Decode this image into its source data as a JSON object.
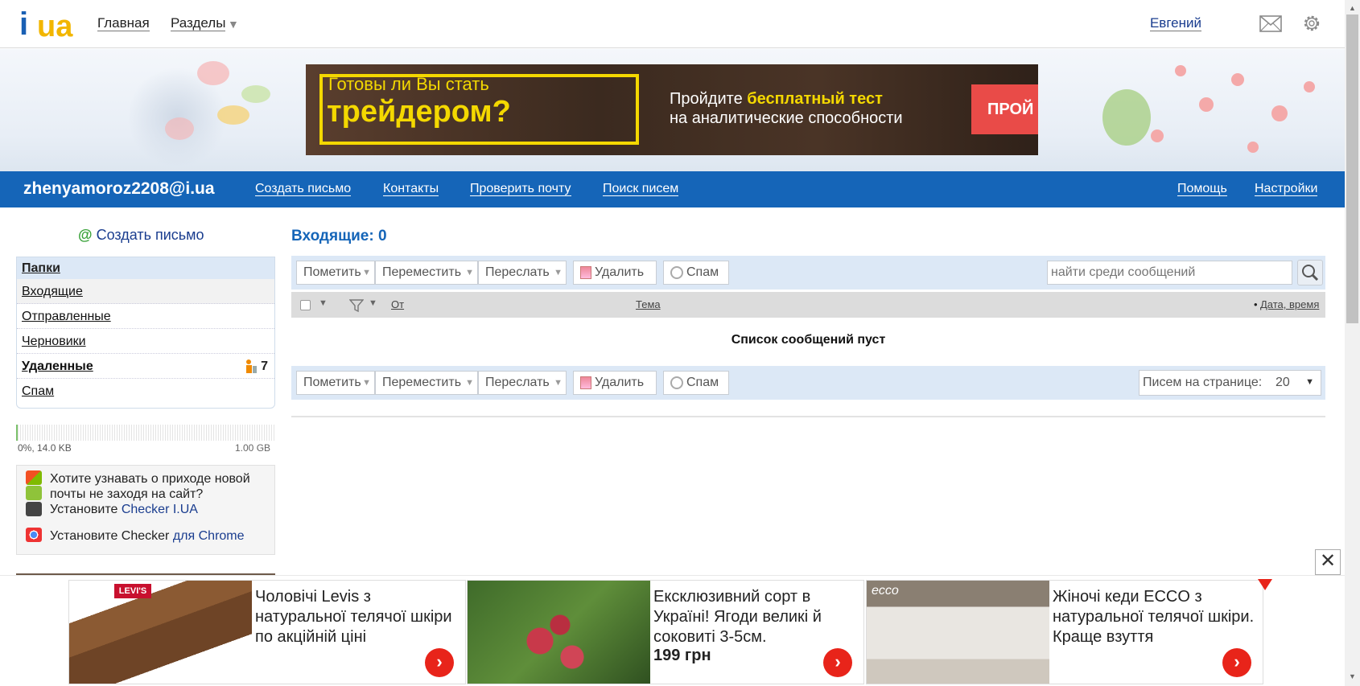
{
  "topbar": {
    "logo_i": "i",
    "logo_ua": "ua",
    "nav_home": "Главная",
    "nav_sections": "Разделы",
    "user_name": "Евгений",
    "icons": [
      "mail-icon",
      "gear-icon"
    ]
  },
  "ad_banner": {
    "question_line1": "Готовы ли Вы стать",
    "question_line2": "трейдером?",
    "offer_prefix": "Пройдите ",
    "offer_highlight": "бесплатный тест",
    "offer_line2": "на аналитические способности",
    "cta": "ПРОЙ"
  },
  "bluebar": {
    "account": "zhenyamoroz2208@i.ua",
    "links": {
      "compose": "Создать письмо",
      "contacts": "Контакты",
      "check_mail": "Проверить почту",
      "search_mail": "Поиск писем",
      "help": "Помощь",
      "settings": "Настройки"
    }
  },
  "sidebar": {
    "compose_at": "@",
    "compose_label": "Создать письмо",
    "folders_header": "Папки",
    "folders": [
      {
        "label": "Входящие"
      },
      {
        "label": "Отправленные"
      },
      {
        "label": "Черновики"
      },
      {
        "label": "Удаленные",
        "count": "7"
      },
      {
        "label": "Спам"
      }
    ],
    "quota_used": "0%, 14.0 KB",
    "quota_total": "1.00 GB",
    "checker": {
      "line1": "Хотите узнавать о приходе новой",
      "line2": "почты не заходя на сайт?",
      "line3_prefix": "Установите ",
      "line3_link": "Checker I.UA",
      "line4_prefix": "Установите Checker ",
      "line4_link": "для Chrome"
    }
  },
  "main": {
    "title": "Входящие: 0",
    "toolbar": {
      "mark": "Пометить",
      "move": "Переместить",
      "forward": "Переслать",
      "delete": "Удалить",
      "spam": "Спам",
      "search_placeholder": "найти среди сообщений"
    },
    "columns": {
      "from": "От",
      "subject": "Тема",
      "date": "Дата, время"
    },
    "empty_message": "Список сообщений пуст",
    "per_page_label": "Писем на странице:",
    "per_page_value": "20"
  },
  "bottom_ads": {
    "close": "✕",
    "cards": [
      {
        "brand": "LEVI'S",
        "text": "Чоловічі Levis з натуральної телячої шкіри по акційній ціні",
        "price": ""
      },
      {
        "brand": "",
        "text": "Ексклюзивний сорт в Україні! Ягоди великі й соковиті 3-5см.",
        "price": "199 грн"
      },
      {
        "brand": "ecco",
        "text": "Жіночі кеди ECCO з натуральної телячої шкіри. Краще взуття",
        "price": ""
      }
    ]
  },
  "colors": {
    "brand_blue": "#1565b8",
    "logo_yellow": "#f2b600",
    "toolbar_bg": "#dce8f6",
    "ad_red": "#e8241a"
  }
}
